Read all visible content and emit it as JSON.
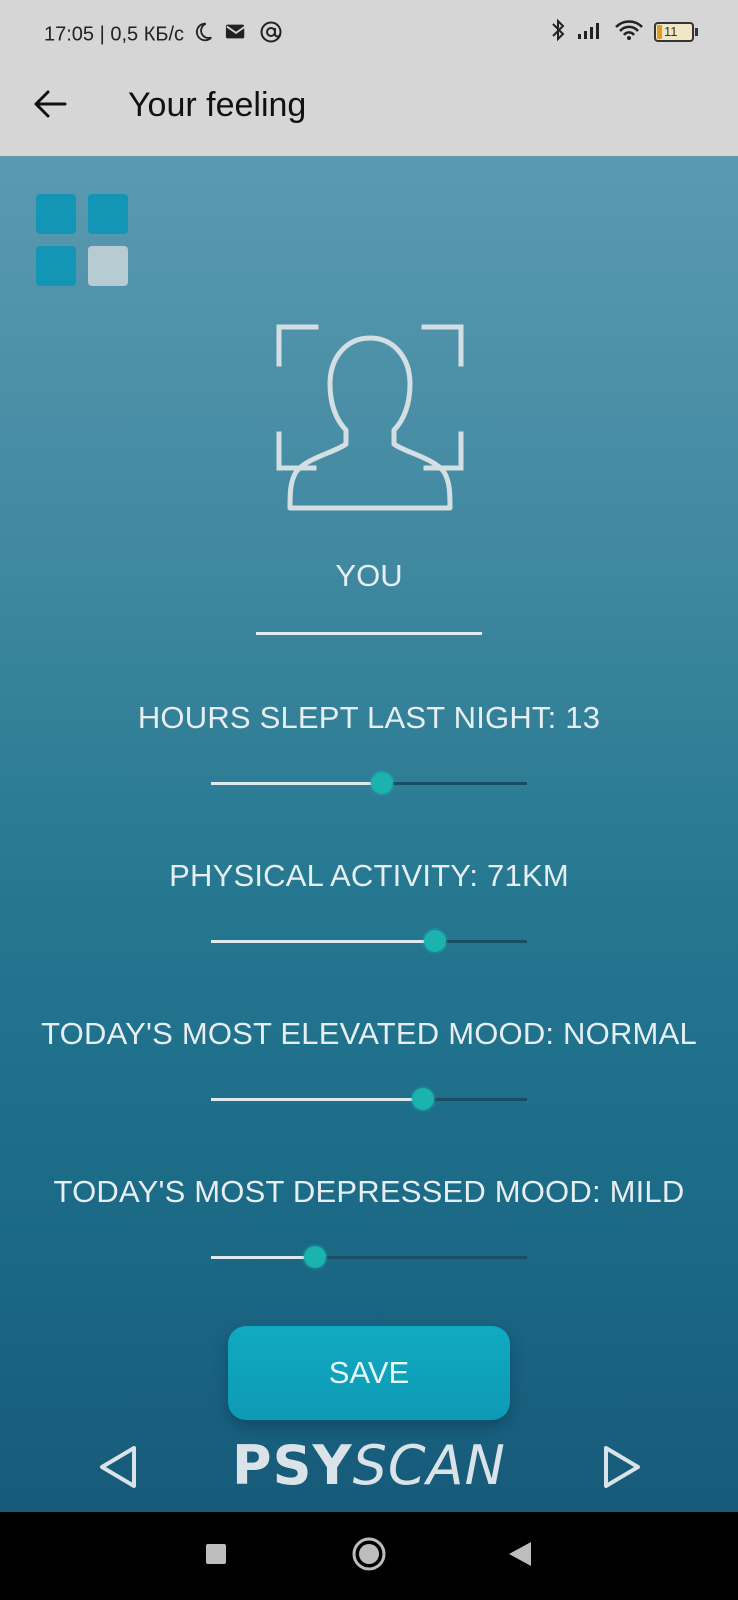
{
  "status_bar": {
    "time_text": "17:05 | 0,5 КБ/с",
    "battery_level": "11"
  },
  "app_bar": {
    "title": "Your feeling"
  },
  "profile": {
    "label": "YOU"
  },
  "settings": [
    {
      "label": "HOURS SLEPT LAST NIGHT: 13",
      "value_fraction": 0.54
    },
    {
      "label": "PHYSICAL ACTIVITY: 71KM",
      "value_fraction": 0.71
    },
    {
      "label": "TODAY'S MOST ELEVATED MOOD: NORMAL",
      "value_fraction": 0.67
    },
    {
      "label": "TODAY'S MOST DEPRESSED MOOD: MILD",
      "value_fraction": 0.33
    }
  ],
  "actions": {
    "save_label": "SAVE"
  },
  "brand": {
    "strong": "PSY",
    "light": "SCAN"
  },
  "colors": {
    "accent_teal": "#1ab3ad",
    "save_button": "#11a9c2",
    "grid_active": "#1396b5",
    "grid_inactive": "#b7cbd2"
  }
}
